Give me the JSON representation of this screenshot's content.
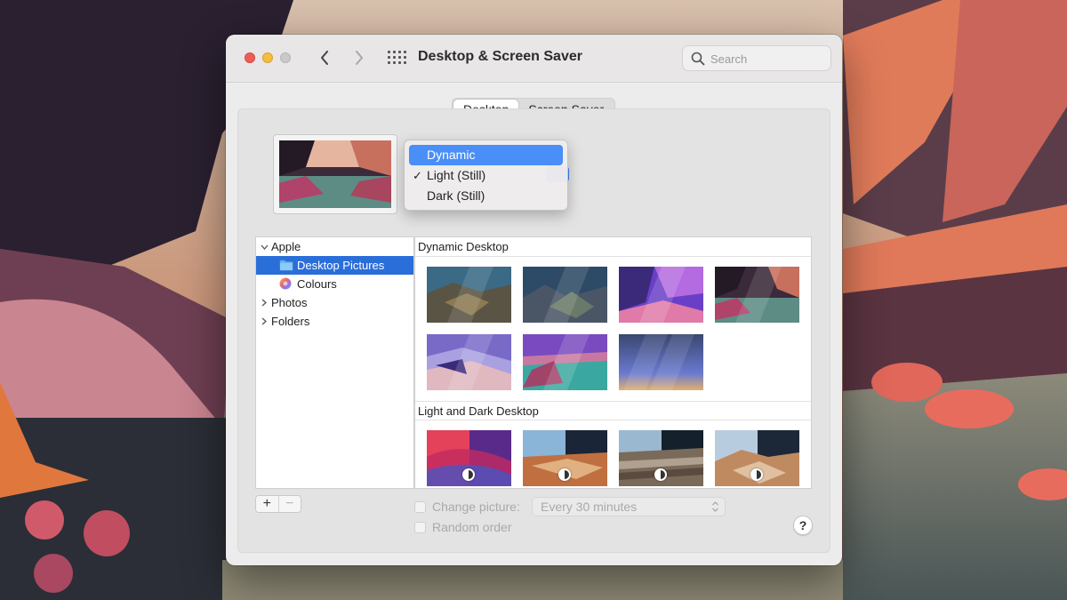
{
  "window": {
    "title": "Desktop & Screen Saver"
  },
  "search": {
    "placeholder": "Search"
  },
  "tabs": [
    {
      "label": "Desktop",
      "active": true
    },
    {
      "label": "Screen Saver",
      "active": false
    }
  ],
  "appearance_menu": {
    "items": [
      {
        "label": "Dynamic",
        "highlighted": true,
        "checked": false
      },
      {
        "label": "Light (Still)",
        "highlighted": false,
        "checked": true
      },
      {
        "label": "Dark (Still)",
        "highlighted": false,
        "checked": false
      }
    ],
    "check_glyph": "✓"
  },
  "sidebar": {
    "apple": "Apple",
    "desktop_pictures": "Desktop Pictures",
    "colours": "Colours",
    "photos": "Photos",
    "folders": "Folders"
  },
  "gallery": {
    "dynamic_heading": "Dynamic Desktop",
    "light_dark_heading": "Light and Dark Desktop"
  },
  "controls": {
    "add": "+",
    "remove": "−",
    "change_picture": "Change picture:",
    "interval": "Every 30 minutes",
    "random_order": "Random order",
    "help": "?"
  },
  "colors": {
    "accent": "#2a6ed9",
    "menu_highlight": "#4a8ef8",
    "close": "#ee5e55",
    "minimize": "#f5be3e"
  }
}
